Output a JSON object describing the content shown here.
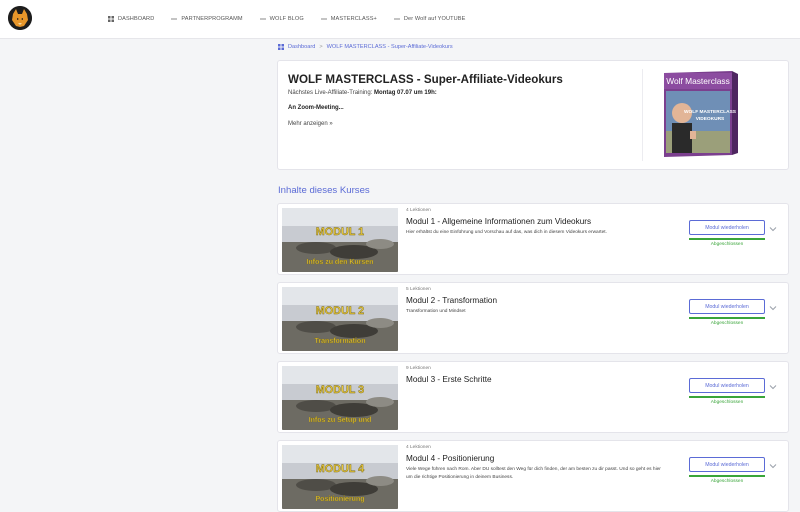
{
  "nav": {
    "items": [
      {
        "label": "DASHBOARD",
        "icon": "grid-icon"
      },
      {
        "label": "PARTNERPROGRAMM",
        "icon": "dash-icon"
      },
      {
        "label": "WOLF BLOG",
        "icon": "dash-icon"
      },
      {
        "label": "MASTERCLASS+",
        "icon": "dash-icon"
      },
      {
        "label": "Der Wolf auf YOUTUBE",
        "icon": "dash-icon"
      }
    ]
  },
  "breadcrumb": {
    "home": "Dashboard",
    "current": "WOLF MASTERCLASS - Super-Affiliate-Videokurs"
  },
  "header": {
    "title": "WOLF MASTERCLASS - Super-Affiliate-Videokurs",
    "next_label": "Nächstes  Live-Affiliate-Training:",
    "next_date": "Montag 07.07 um 19h:",
    "zoom": "An Zoom-Meeting...",
    "more": "Mehr anzeigen »",
    "cover": {
      "title": "Wolf Masterclass",
      "line1": "WOLF MASTERCLASS",
      "line2": "VIDEOKURS"
    }
  },
  "section_title": "Inhalte dieses Kurses",
  "modules": [
    {
      "lessons": "4 Lektionen",
      "title": "Modul 1 - Allgemeine Informationen zum Videokurs",
      "desc": "Hier erhältst du eine Einführung und Vorschau auf das, was dich in diesem Videokurs erwartet.",
      "thumb_top": "MODUL 1",
      "thumb_bottom": "Infos zu den Kursen",
      "button": "Modul wiederholen",
      "status": "Abgeschlossen",
      "progress": 1.0
    },
    {
      "lessons": "5 Lektionen",
      "title": "Modul 2 - Transformation",
      "desc": "Transformation und Mindset",
      "thumb_top": "MODUL 2",
      "thumb_bottom": "Transformation",
      "button": "Modul wiederholen",
      "status": "Abgeschlossen",
      "progress": 1.0
    },
    {
      "lessons": "9 Lektionen",
      "title": "Modul 3 - Erste Schritte",
      "desc": "",
      "thumb_top": "MODUL 3",
      "thumb_bottom": "Infos zu Setup und",
      "button": "Modul wiederholen",
      "status": "Abgeschlossen",
      "progress": 1.0
    },
    {
      "lessons": "4 Lektionen",
      "title": "Modul 4 - Positionierung",
      "desc": "Viele Wege führen nach Rom. Aber DU solltest den Weg für dich finden, der am besten zu dir passt. Und so geht es hier um die richtige Positionierung in deinem Business.",
      "thumb_top": "MODUL 4",
      "thumb_bottom": "Positionierung",
      "button": "Modul wiederholen",
      "status": "Abgeschlossen",
      "progress": 1.0
    }
  ],
  "colors": {
    "accent": "#5b6bd6",
    "success": "#3aa53a"
  }
}
